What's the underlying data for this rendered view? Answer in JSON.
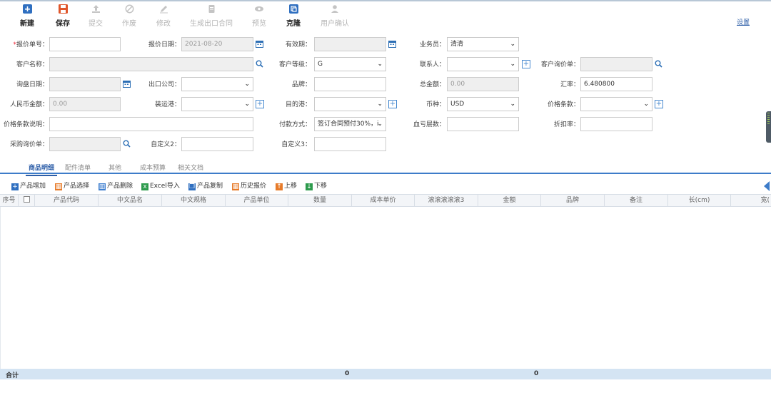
{
  "toolbar": {
    "new": "新建",
    "save": "保存",
    "submit": "提交",
    "void": "作废",
    "edit": "修改",
    "generate_contract": "生成出口合同",
    "preview": "预览",
    "clone": "克隆",
    "user_confirm": "用户确认",
    "settings": "设置"
  },
  "form": {
    "quote_no": {
      "label": "报价单号：",
      "required_mark": "*",
      "value": ""
    },
    "quote_date": {
      "label": "报价日期：",
      "value": "2021-08-20"
    },
    "valid_until": {
      "label": "有效期：",
      "value": ""
    },
    "salesperson": {
      "label": "业务员：",
      "value": "清清"
    },
    "customer_name": {
      "label": "客户名称：",
      "value": ""
    },
    "customer_level": {
      "label": "客户等级：",
      "value": "G"
    },
    "contact": {
      "label": "联系人：",
      "value": ""
    },
    "customer_inquiry": {
      "label": "客户询价单：",
      "value": ""
    },
    "inquiry_date": {
      "label": "询盘日期：",
      "value": ""
    },
    "export_company": {
      "label": "出口公司：",
      "value": ""
    },
    "brand": {
      "label": "品牌：",
      "value": ""
    },
    "total_amount": {
      "label": "总金额：",
      "value": "0.00"
    },
    "exchange_rate": {
      "label": "汇率：",
      "value": "6.480800"
    },
    "rmb_amount": {
      "label": "人民币金额：",
      "value": "0.00"
    },
    "loading_port": {
      "label": "装运港：",
      "value": ""
    },
    "destination_port": {
      "label": "目的港：",
      "value": ""
    },
    "currency": {
      "label": "币种：",
      "value": "USD"
    },
    "price_terms": {
      "label": "价格条款：",
      "value": ""
    },
    "price_terms_desc": {
      "label": "价格条款说明：",
      "value": ""
    },
    "payment_method": {
      "label": "付款方式：",
      "value": "签订合同预付30%，i"
    },
    "blood_layers": {
      "label": "血亏层数：",
      "value": ""
    },
    "discount_rate": {
      "label": "折扣率：",
      "value": ""
    },
    "purchase_inquiry": {
      "label": "采购询价单：",
      "value": ""
    },
    "custom2": {
      "label": "自定义2：",
      "value": ""
    },
    "custom3": {
      "label": "自定义3：",
      "value": ""
    }
  },
  "tabs": [
    "商品明细",
    "配件清单",
    "其他",
    "成本预算",
    "相关文档"
  ],
  "product_toolbar": [
    "产品增加",
    "产品选择",
    "产品删除",
    "Excel导入",
    "产品复制",
    "历史报价",
    "上移",
    "下移"
  ],
  "grid": {
    "columns": [
      "序号",
      "",
      "产品代码",
      "中文品名",
      "中文规格",
      "产品单位",
      "数量",
      "成本单价",
      "滚滚滚滚滚3",
      "金额",
      "品牌",
      "备注",
      "长(cm)",
      "宽("
    ]
  },
  "footer": {
    "label": "合计",
    "qty_total": "0",
    "amount_total": "0"
  },
  "colors": {
    "accent": "#3d7cc9",
    "footer_bg": "#d4e4f3"
  }
}
